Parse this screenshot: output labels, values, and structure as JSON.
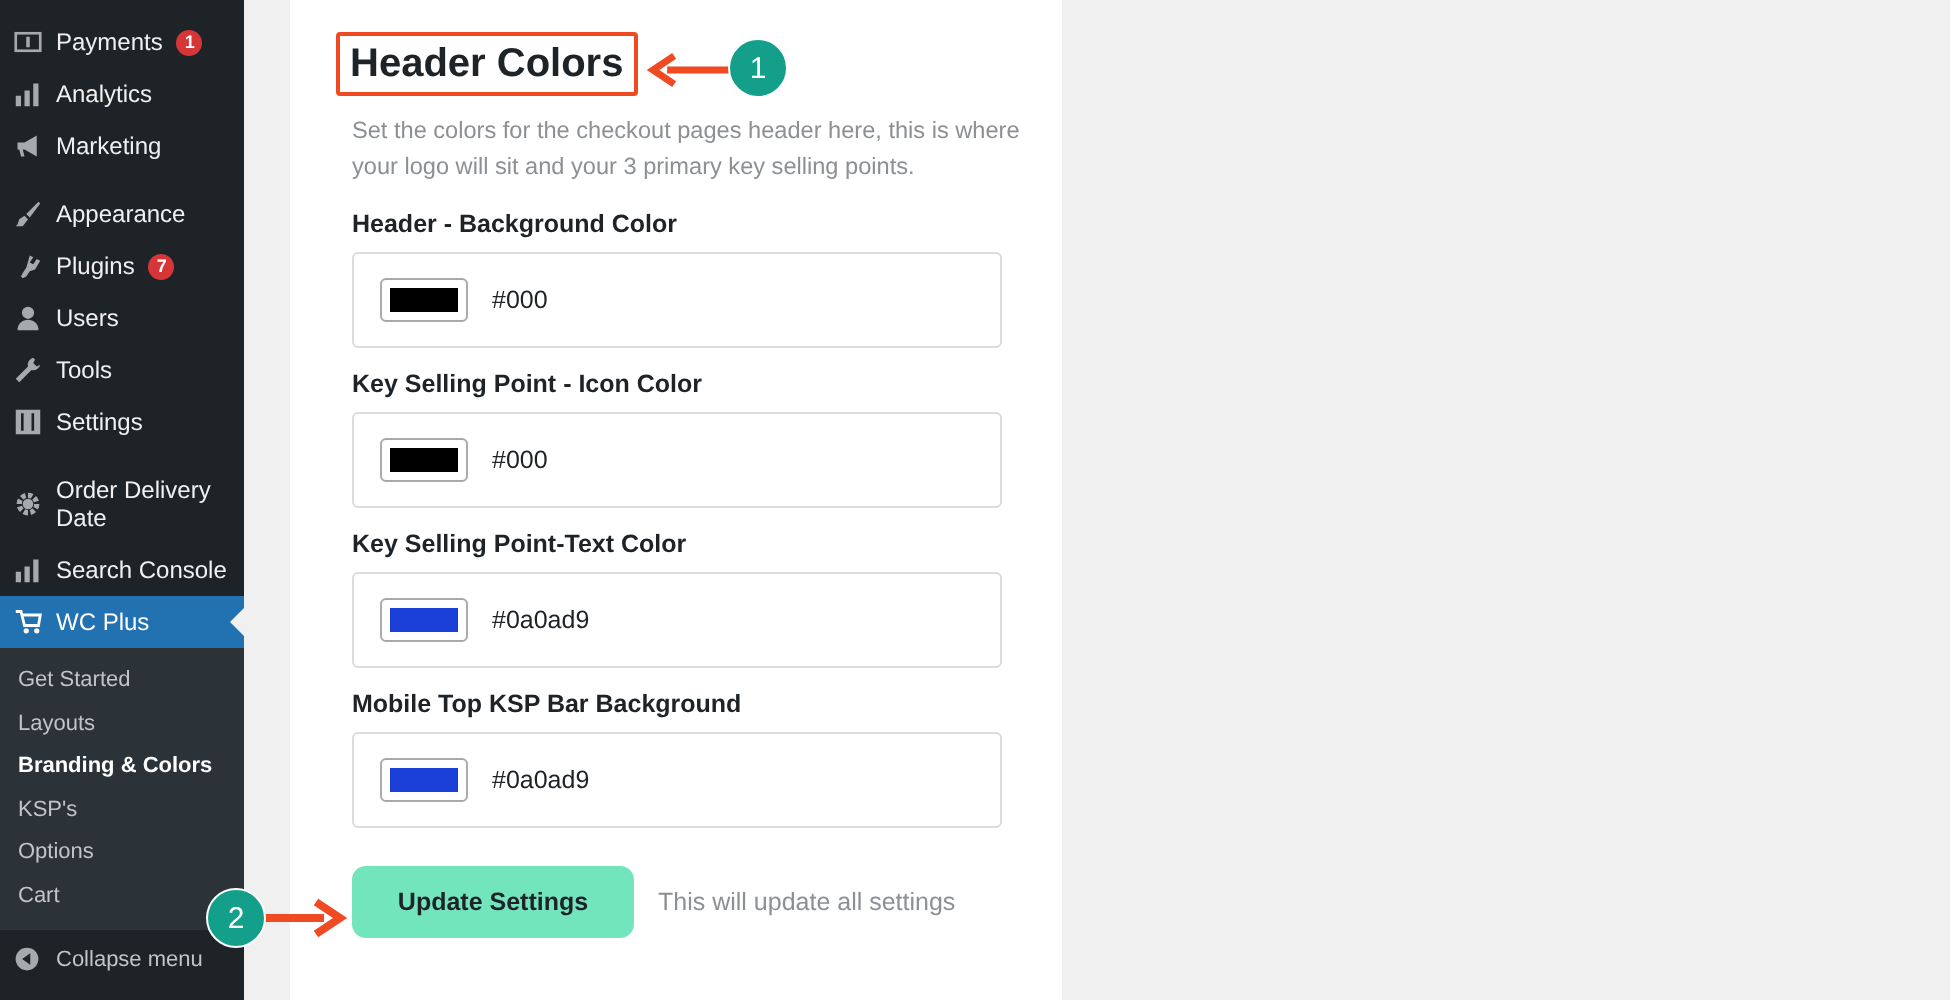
{
  "sidebar": {
    "groups": [
      [
        {
          "kind": "payments",
          "label": "Payments",
          "badge": "1",
          "selected": false
        },
        {
          "kind": "analytics",
          "label": "Analytics",
          "selected": false
        },
        {
          "kind": "marketing",
          "label": "Marketing",
          "selected": false
        }
      ],
      [
        {
          "kind": "appearance",
          "label": "Appearance",
          "selected": false
        },
        {
          "kind": "plugins",
          "label": "Plugins",
          "badge": "7",
          "selected": false
        },
        {
          "kind": "users",
          "label": "Users",
          "selected": false
        },
        {
          "kind": "tools",
          "label": "Tools",
          "selected": false
        },
        {
          "kind": "settings",
          "label": "Settings",
          "selected": false
        }
      ],
      [
        {
          "kind": "gear",
          "label": "Order Delivery Date",
          "selected": false
        },
        {
          "kind": "analytics",
          "label": "Search Console",
          "selected": false
        },
        {
          "kind": "cart",
          "label": "WC Plus",
          "selected": true
        }
      ]
    ],
    "submenu": [
      {
        "label": "Get Started",
        "selected": false
      },
      {
        "label": "Layouts",
        "selected": false
      },
      {
        "label": "Branding & Colors",
        "selected": true
      },
      {
        "label": "KSP's",
        "selected": false
      },
      {
        "label": "Options",
        "selected": false
      },
      {
        "label": "Cart",
        "selected": false
      }
    ],
    "collapse": "Collapse menu"
  },
  "section": {
    "title": "Header Colors",
    "description": "Set the colors for the checkout pages header here, this is where your logo will sit and your 3 primary key selling points.",
    "fields": [
      {
        "label": "Header - Background Color",
        "value": "#000",
        "color": "#000000"
      },
      {
        "label": "Key Selling Point - Icon Color",
        "value": "#000",
        "color": "#000000"
      },
      {
        "label": "Key Selling Point-Text Color",
        "value": "#0a0ad9",
        "color": "#1a3fd6"
      },
      {
        "label": "Mobile Top KSP Bar Background",
        "value": "#0a0ad9",
        "color": "#1a3fd6"
      }
    ],
    "button": "Update Settings",
    "note": "This will update all settings"
  },
  "annotations": [
    {
      "number": "1"
    },
    {
      "number": "2"
    }
  ]
}
